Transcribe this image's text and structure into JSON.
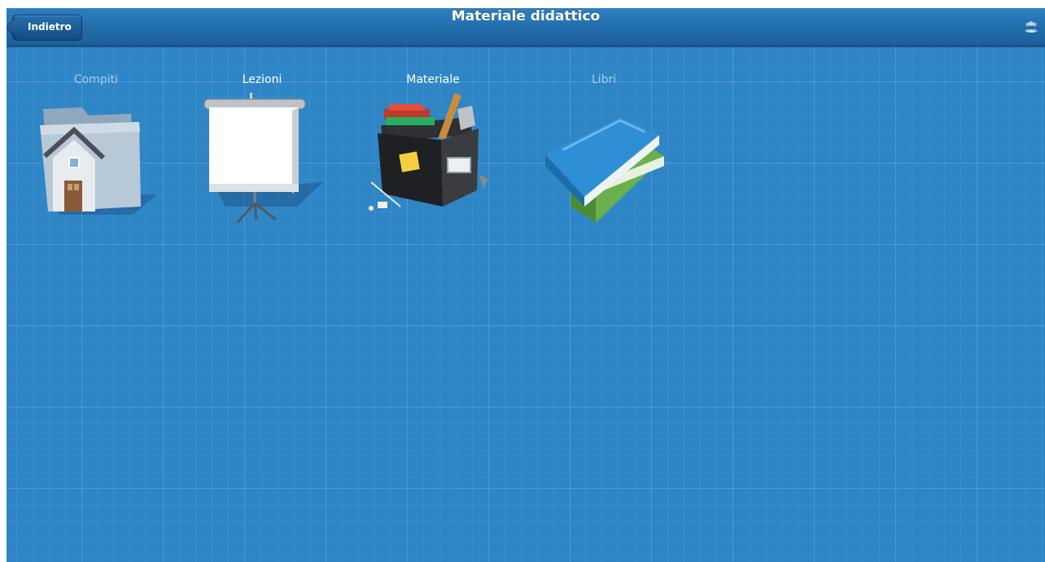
{
  "navbar": {
    "back_label": "Indietro",
    "title": "Materiale didattico",
    "users_icon": "users-icon"
  },
  "tiles": [
    {
      "label": "Compiti",
      "icon": "folder-house-icon",
      "enabled": false
    },
    {
      "label": "Lezioni",
      "icon": "projector-screen-icon",
      "enabled": true
    },
    {
      "label": "Materiale",
      "icon": "supply-box-icon",
      "enabled": true
    },
    {
      "label": "Libri",
      "icon": "books-icon",
      "enabled": false
    }
  ],
  "colors": {
    "background": "#2f86c6",
    "navbar": "#1a5f9a",
    "label_active": "#ffffff",
    "label_dimmed": "#a6cce8"
  }
}
